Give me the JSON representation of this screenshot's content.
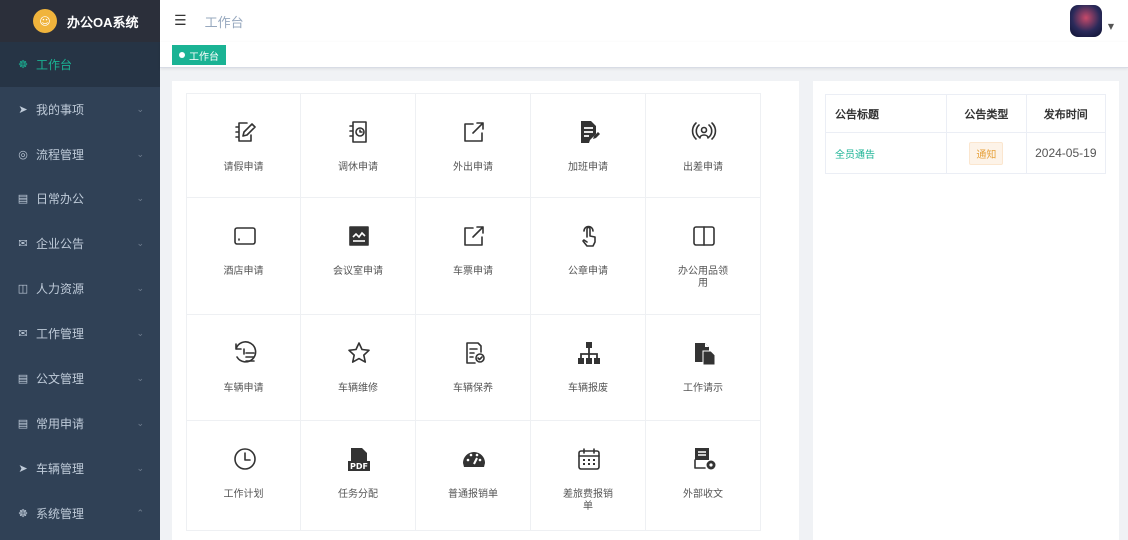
{
  "app": {
    "logo_glyph": "☺",
    "name": "办公OA系统"
  },
  "header": {
    "breadcrumb": "工作台"
  },
  "tags": [
    {
      "label": "工作台"
    }
  ],
  "sidebar": {
    "items": [
      {
        "icon": "dashboard-icon",
        "glyph": "☸",
        "label": "工作台",
        "chevron": ""
      },
      {
        "icon": "send-icon",
        "glyph": "➤",
        "label": "我的事项",
        "chevron": "⌄"
      },
      {
        "icon": "flow-icon",
        "glyph": "◎",
        "label": "流程管理",
        "chevron": "⌄"
      },
      {
        "icon": "doc-icon",
        "glyph": "▤",
        "label": "日常办公",
        "chevron": "⌄"
      },
      {
        "icon": "mail-icon",
        "glyph": "✉",
        "label": "企业公告",
        "chevron": "⌄"
      },
      {
        "icon": "hr-icon",
        "glyph": "◫",
        "label": "人力资源",
        "chevron": "⌄"
      },
      {
        "icon": "mail-icon",
        "glyph": "✉",
        "label": "工作管理",
        "chevron": "⌄"
      },
      {
        "icon": "doc-icon",
        "glyph": "▤",
        "label": "公文管理",
        "chevron": "⌄"
      },
      {
        "icon": "doc-icon",
        "glyph": "▤",
        "label": "常用申请",
        "chevron": "⌄"
      },
      {
        "icon": "send-icon",
        "glyph": "➤",
        "label": "车辆管理",
        "chevron": "⌄"
      },
      {
        "icon": "dashboard-icon",
        "glyph": "☸",
        "label": "系统管理",
        "chevron": "⌃"
      }
    ]
  },
  "apps": [
    {
      "label": "请假申请",
      "icon": "edit-doc-icon"
    },
    {
      "label": "调休申请",
      "icon": "clock-doc-icon"
    },
    {
      "label": "外出申请",
      "icon": "external-link-icon"
    },
    {
      "label": "加班申请",
      "icon": "file-edit-icon"
    },
    {
      "label": "出差申请",
      "icon": "broadcast-icon"
    },
    {
      "label": "酒店申请",
      "icon": "tablet-icon"
    },
    {
      "label": "会议室申请",
      "icon": "monitor-chart-icon"
    },
    {
      "label": "车票申请",
      "icon": "external-link-icon"
    },
    {
      "label": "公章申请",
      "icon": "touch-icon"
    },
    {
      "label": "办公用品领用",
      "icon": "columns-icon"
    },
    {
      "label": "车辆申请",
      "icon": "history-list-icon"
    },
    {
      "label": "车辆维修",
      "icon": "star-icon"
    },
    {
      "label": "车辆保养",
      "icon": "checklist-icon"
    },
    {
      "label": "车辆报废",
      "icon": "org-chart-icon"
    },
    {
      "label": "工作请示",
      "icon": "copy-file-icon"
    },
    {
      "label": "工作计划",
      "icon": "clock-icon"
    },
    {
      "label": "任务分配",
      "icon": "pdf-icon"
    },
    {
      "label": "普通报销单",
      "icon": "speedometer-icon"
    },
    {
      "label": "差旅费报销单",
      "icon": "calendar-icon"
    },
    {
      "label": "外部收文",
      "icon": "settings-doc-icon"
    }
  ],
  "notices": {
    "headers": [
      "公告标题",
      "公告类型",
      "发布时间"
    ],
    "rows": [
      {
        "title": "全员通告",
        "type": "通知",
        "date": "2024-05-19"
      }
    ]
  }
}
